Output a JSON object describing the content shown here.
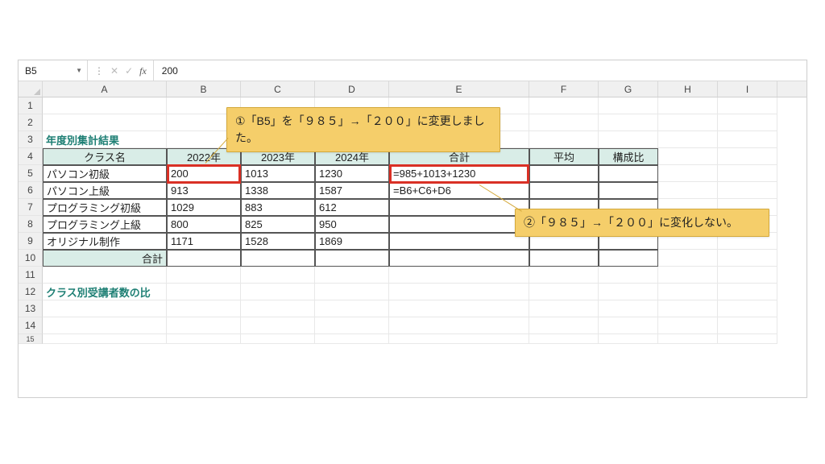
{
  "formula_bar": {
    "name_box": "B5",
    "value": "200"
  },
  "columns": [
    "A",
    "B",
    "C",
    "D",
    "E",
    "F",
    "G",
    "H",
    "I"
  ],
  "section_title_3": "年度別集計結果",
  "section_title_12": "クラス別受講者数の比",
  "headers": {
    "class_name": "クラス名",
    "y2022": "2022年",
    "y2023": "2023年",
    "y2024": "2024年",
    "total": "合計",
    "avg": "平均",
    "ratio": "構成比"
  },
  "rows": [
    {
      "name": "パソコン初級",
      "y2022": "200",
      "y2023": "1013",
      "y2024": "1230",
      "total": "=985+1013+1230"
    },
    {
      "name": "パソコン上級",
      "y2022": "913",
      "y2023": "1338",
      "y2024": "1587",
      "total": "=B6+C6+D6"
    },
    {
      "name": "プログラミング初級",
      "y2022": "1029",
      "y2023": "883",
      "y2024": "612",
      "total": ""
    },
    {
      "name": "プログラミング上級",
      "y2022": "800",
      "y2023": "825",
      "y2024": "950",
      "total": ""
    },
    {
      "name": "オリジナル制作",
      "y2022": "1171",
      "y2023": "1528",
      "y2024": "1869",
      "total": ""
    }
  ],
  "total_row_label": "合計",
  "annotations": {
    "a1": "①「B5」を「９８５」→「２００」に変更しました。",
    "a2": "②「９８５」→「２００」に変化しない。"
  }
}
